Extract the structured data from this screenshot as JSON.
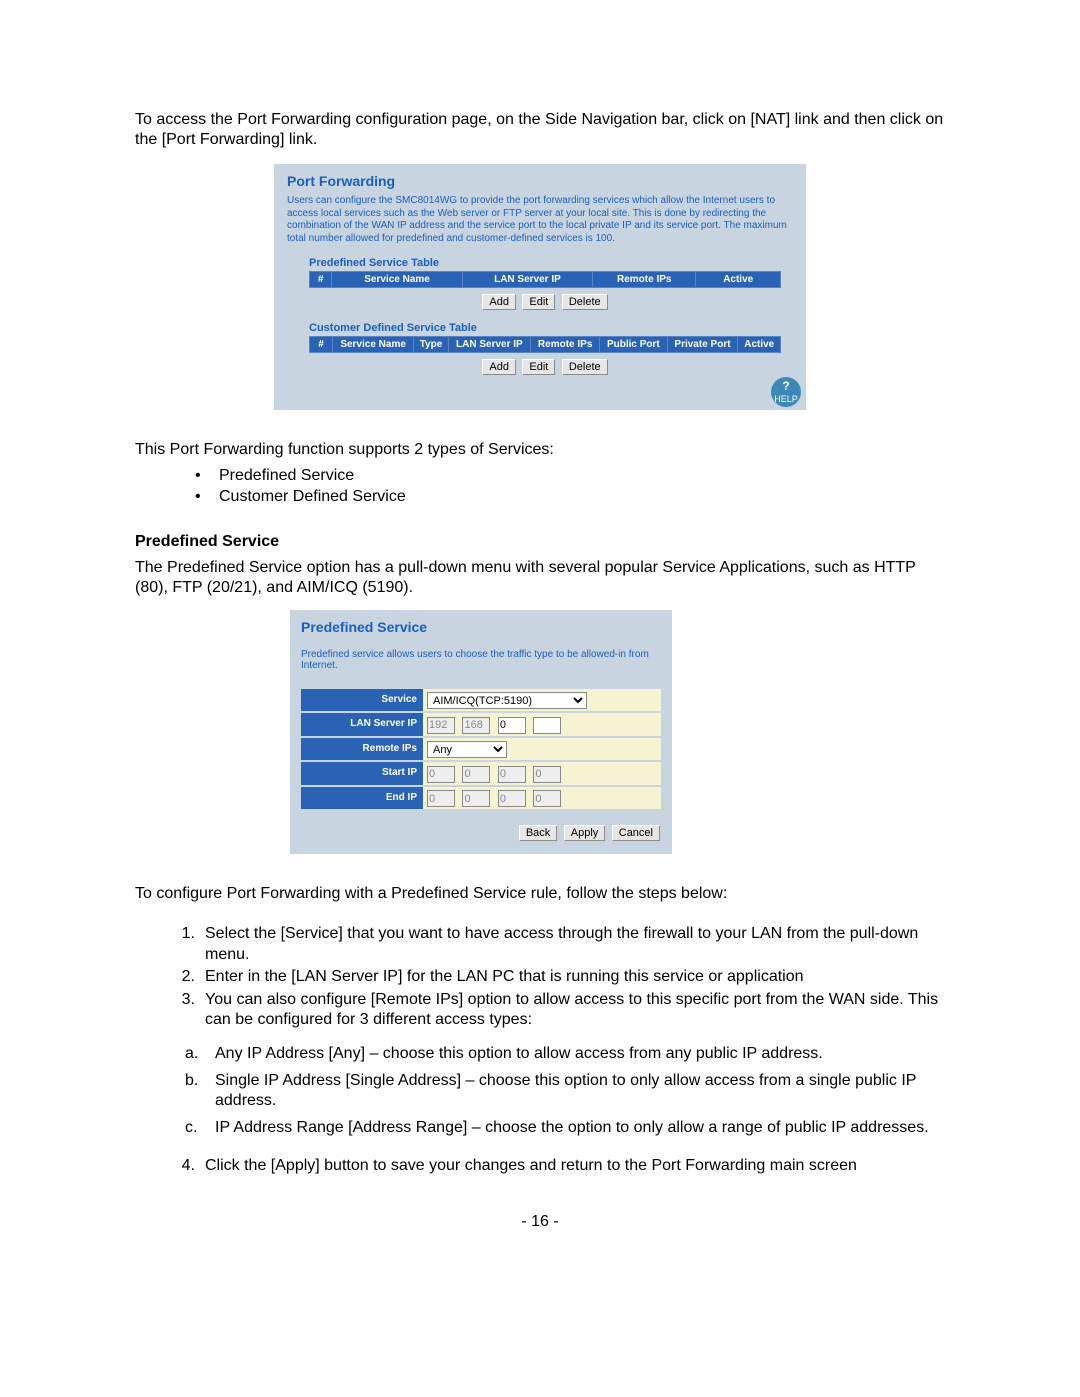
{
  "intro": "To access the Port Forwarding configuration page, on the Side Navigation bar, click on [NAT] link and then click on the [Port Forwarding] link.",
  "panel": {
    "title": "Port Forwarding",
    "desc": "Users can configure the SMC8014WG to provide the port forwarding services which allow the Internet users to access local services such as the Web server or FTP server at your local site. This is done by redirecting the combination of the WAN IP address and the service port to the local private IP and its service port. The maximum total number allowed for predefined and customer-defined services is 100.",
    "predef_label": "Predefined Service Table",
    "predef_headers": [
      "#",
      "Service Name",
      "LAN Server IP",
      "Remote IPs",
      "Active"
    ],
    "cust_label": "Customer Defined Service Table",
    "cust_headers": [
      "#",
      "Service Name",
      "Type",
      "LAN Server IP",
      "Remote IPs",
      "Public Port",
      "Private Port",
      "Active"
    ],
    "btn_add": "Add",
    "btn_edit": "Edit",
    "btn_delete": "Delete",
    "help": "HELP"
  },
  "mid1": "This Port Forwarding function supports 2 types of Services:",
  "bullets": [
    "Predefined Service",
    "Customer Defined Service"
  ],
  "predef_heading": "Predefined Service",
  "predef_body": "The Predefined Service option has a pull-down menu with several popular Service Applications, such as HTTP (80), FTP (20/21), and AIM/ICQ (5190).",
  "ps": {
    "title": "Predefined Service",
    "desc": "Predefined service allows users to choose the traffic type to be allowed-in from Internet.",
    "labels": {
      "service": "Service",
      "lan": "LAN Server IP",
      "remote": "Remote IPs",
      "start": "Start IP",
      "end": "End IP"
    },
    "service_value": "AIM/ICQ(TCP:5190)",
    "lan": [
      "192",
      "168",
      "0",
      ""
    ],
    "remote_value": "Any",
    "start": [
      "0",
      "0",
      "0",
      "0"
    ],
    "end": [
      "0",
      "0",
      "0",
      "0"
    ],
    "btn_back": "Back",
    "btn_apply": "Apply",
    "btn_cancel": "Cancel"
  },
  "steps_intro": "To configure Port Forwarding with a Predefined Service rule, follow the steps below:",
  "steps": [
    "Select the [Service] that you want to have access through the firewall to your LAN from the pull-down menu.",
    "Enter in the [LAN Server IP] for the LAN PC that is running this service or application",
    "You can also configure [Remote IPs] option to allow access to this specific port from the WAN side. This can be configured for 3 different access types:"
  ],
  "substeps": [
    "Any IP Address [Any] – choose this option to allow access from any public IP address.",
    "Single IP Address [Single Address] – choose this option to only allow access from a single public IP address.",
    "IP Address Range [Address Range] – choose the option to only allow a range of public IP addresses."
  ],
  "step4": "Click the [Apply] button to save your changes and return to the Port Forwarding main screen",
  "pagenum": "- 16 -"
}
